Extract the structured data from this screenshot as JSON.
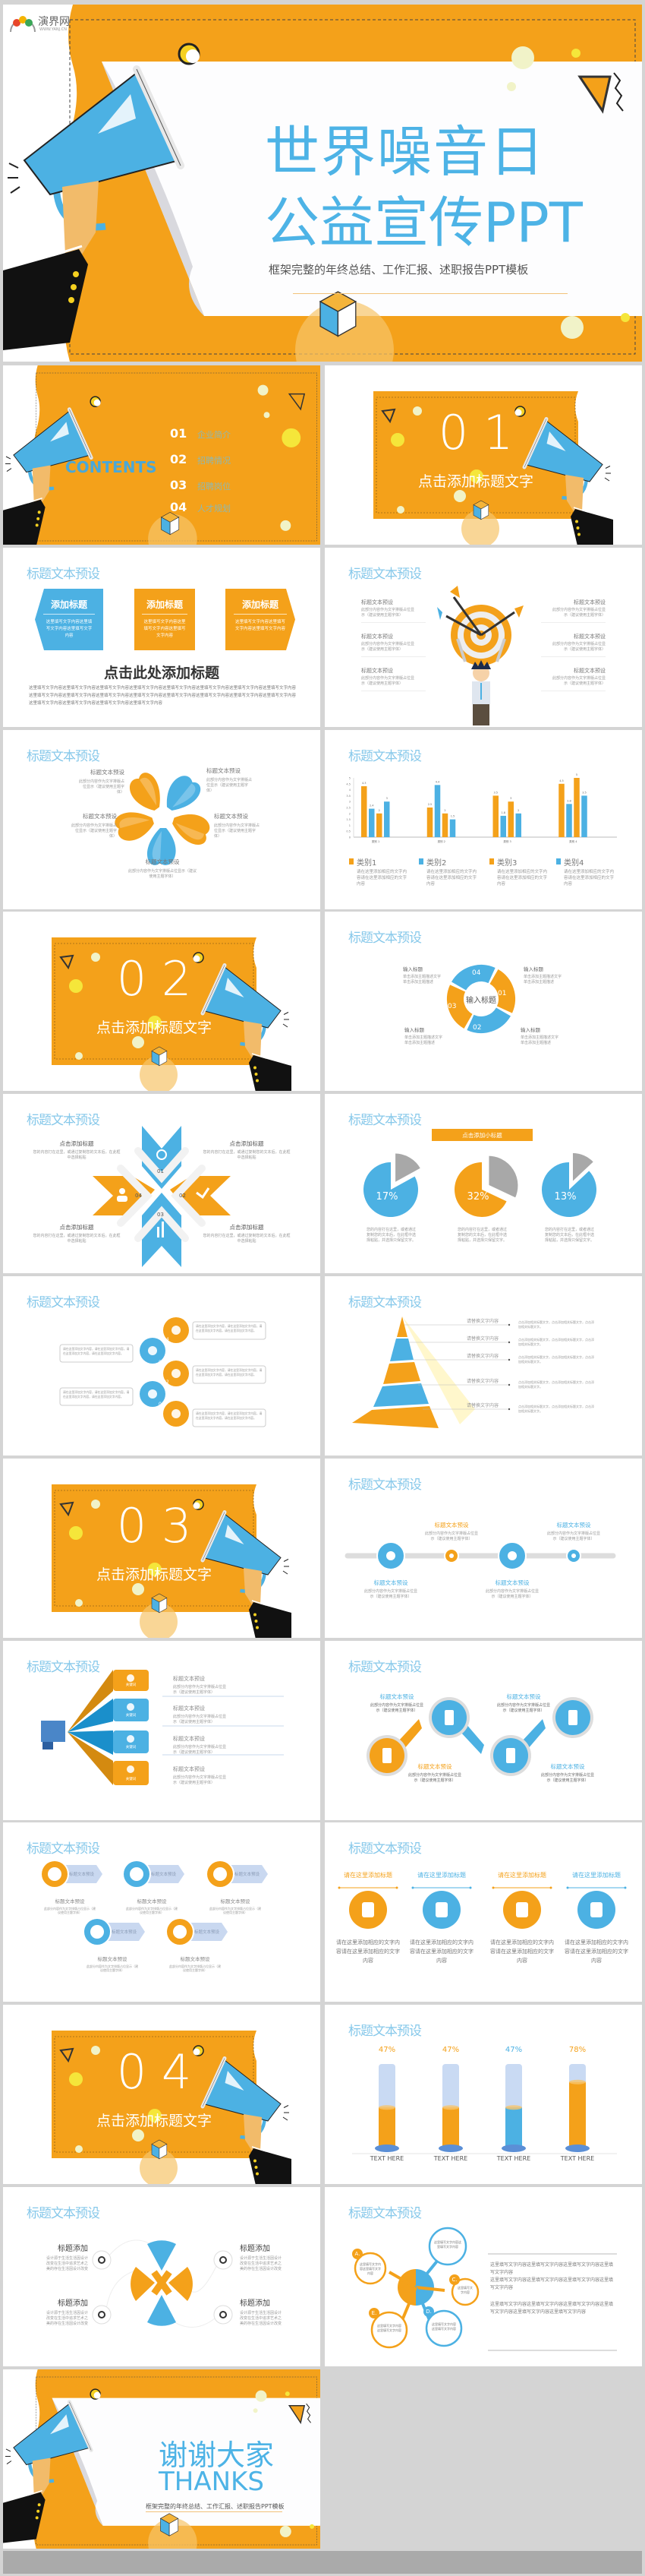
{
  "brand": {
    "logo_text": "演界网",
    "logo_url": "WWW.YANJ.CN"
  },
  "colors": {
    "orange": "#f4a11a",
    "blue": "#4cb1e3",
    "title_blue": "#86c8ea",
    "page_bg": "#d4d4d4",
    "sleeve": "#111111",
    "hand": "#f2bb6a"
  },
  "cover": {
    "title_line1": "世界噪音日",
    "title_line2": "公益宣传PPT",
    "subtitle": "框架完整的年终总结、工作汇报、述职报告PPT模板"
  },
  "slide_title": "标题文本预设",
  "contents": {
    "heading": "CONTENTS",
    "items": [
      {
        "num": "01",
        "label": "企业简介"
      },
      {
        "num": "02",
        "label": "招聘情况"
      },
      {
        "num": "03",
        "label": "招聘岗位"
      },
      {
        "num": "04",
        "label": "人才规划"
      }
    ]
  },
  "sections": [
    {
      "number": "0 1",
      "title": "点击添加标题文字"
    },
    {
      "number": "0 2",
      "title": "点击添加标题文字"
    },
    {
      "number": "0 3",
      "title": "点击添加标题文字"
    },
    {
      "number": "0 4",
      "title": "点击添加标题文字"
    }
  ],
  "three_boxes": {
    "boxes": [
      {
        "title": "添加标题",
        "text": "这里填写文字内容这里填写文字内容这里填写文字内容"
      },
      {
        "title": "添加标题",
        "text": "这里填写文字内容这里填写文字内容这里填写文字内容"
      },
      {
        "title": "添加标题",
        "text": "这里填写文字内容这里填写文字内容这里填写文字内容"
      }
    ],
    "heading": "点击此处添加标题",
    "paragraph": "这里填写文字内容这里填写文字内容这里填写文字内容这里填写文字内容这里填写文字内容这里填写文字内容这里填写文字内容这里填写文字内容这里填写文字内容这里填写文字内容这里填写文字内容这里填写文字内容这里填写文字内容这里填写文字内容这里填写文字内容这里填写文字内容这里填写文字内容这里填写文字内容这里填写文字内容这里填写文字内容"
  },
  "target": {
    "items": [
      {
        "title": "标题文本预设",
        "text": "此部分内容作为文字排版占位显示（建议使用主题字体）"
      },
      {
        "title": "标题文本预设",
        "text": "此部分内容作为文字排版占位显示（建议使用主题字体）"
      },
      {
        "title": "标题文本预设",
        "text": "此部分内容作为文字排版占位显示（建议使用主题字体）"
      },
      {
        "title": "标题文本预设",
        "text": "此部分内容作为文字排版占位显示（建议使用主题字体）"
      },
      {
        "title": "标题文本预设",
        "text": "此部分内容作为文字排版占位显示（建议使用主题字体）"
      },
      {
        "title": "标题文本预设",
        "text": "此部分内容作为文字排版占位显示（建议使用主题字体）"
      }
    ]
  },
  "flower": {
    "items": [
      {
        "title": "标题文本预设",
        "text": "此部分内容作为文字排版占位显示（建议使用主题字体）"
      },
      {
        "title": "标题文本预设",
        "text": "此部分内容作为文字排版占位显示（建议使用主题字体）"
      },
      {
        "title": "标题文本预设",
        "text": "此部分内容作为文字排版占位显示（建议使用主题字体）"
      },
      {
        "title": "标题文本预设",
        "text": "此部分内容作为文字排版占位显示（建议使用主题字体）"
      },
      {
        "title": "标题文本预设",
        "text": "此部分内容作为文字排版占位显示（建议使用主题字体）"
      }
    ]
  },
  "chart_data": {
    "type": "bar",
    "categories": [
      "类别 1",
      "类别 2",
      "类别 3",
      "类别 4"
    ],
    "series": [
      {
        "name": "类别1",
        "color": "#f4a11a",
        "values": [
          4.3,
          2.5,
          3.5,
          4.5
        ]
      },
      {
        "name": "类别2",
        "color": "#4cb1e3",
        "values": [
          2.4,
          4.4,
          1.8,
          2.8
        ]
      },
      {
        "name": "类别3",
        "color": "#f4a11a",
        "values": [
          2,
          2,
          3,
          5
        ]
      },
      {
        "name": "类别4",
        "color": "#4cb1e3",
        "values": [
          3,
          1.5,
          2,
          3.5
        ]
      }
    ],
    "ylim": [
      0,
      5
    ],
    "yticks": [
      "0",
      "0.5",
      "1",
      "1.5",
      "2",
      "2.5",
      "3",
      "3.5",
      "4",
      "4.5",
      "5"
    ],
    "grid": false,
    "data_labels": true,
    "legend_placement": "bottom",
    "legend_descriptions": [
      "请在这里添加相应的文字内容请在这里添加相应的文字内容",
      "请在这里添加相应的文字内容请在这里添加相应的文字内容",
      "请在这里添加相应的文字内容请在这里添加相应的文字内容",
      "请在这里添加相应的文字内容请在这里添加相应的文字内容"
    ]
  },
  "cycle": {
    "center": "输入标题",
    "segments": [
      "01",
      "02",
      "03",
      "04"
    ],
    "items": [
      {
        "title": "输入标题",
        "text": "单击添加主题描述文字单击添加主题描述"
      },
      {
        "title": "输入标题",
        "text": "单击添加主题描述文字单击添加主题描述"
      },
      {
        "title": "输入标题",
        "text": "单击添加主题描述文字单击添加主题描述"
      },
      {
        "title": "输入标题",
        "text": "单击添加主题描述文字单击添加主题描述"
      }
    ]
  },
  "cross": {
    "numbers": [
      "01",
      "02",
      "03",
      "04"
    ],
    "icons": [
      "lightbulb-icon",
      "twitter-icon",
      "bar-chart-icon",
      "users-icon"
    ],
    "items": [
      {
        "title": "点击添加标题",
        "text": "您的内容打在这里，或通过复制您的文本后，在此框中选择粘贴"
      },
      {
        "title": "点击添加标题",
        "text": "您的内容打在这里，或通过复制您的文本后，在此框中选择粘贴"
      },
      {
        "title": "点击添加标题",
        "text": "您的内容打在这里，或通过复制您的文本后，在此框中选择粘贴"
      },
      {
        "title": "点击添加标题",
        "text": "您的内容打在这里，或通过复制您的文本后，在此框中选择粘贴"
      }
    ]
  },
  "pies": {
    "banner": "点击添加小标题",
    "items": [
      {
        "percent": 17,
        "label": "17%",
        "color": "#4cb1e3",
        "text": "您的内容打在这里，或者通过复制您的文本后，在此框中选择粘贴，并选择只保留文字。"
      },
      {
        "percent": 32,
        "label": "32%",
        "color": "#f4a11a",
        "text": "您的内容打在这里，或者通过复制您的文本后，在此框中选择粘贴，并选择只保留文字。"
      },
      {
        "percent": 13,
        "label": "13%",
        "color": "#4cb1e3",
        "text": "您的内容打在这里，或者通过复制您的文本后，在此框中选择粘贴，并选择只保留文字。"
      }
    ]
  },
  "chain": {
    "numbers": [
      "01",
      "02",
      "03",
      "04"
    ],
    "icons": [
      "pen-icon",
      "thumbs-up-icon",
      "mail-icon",
      "truck-icon",
      "pie-chart-icon"
    ],
    "text": "请在这里添加文字内容，请在这里添加文字内容。请在这里添加文字内容，请在这里添加文字内容。"
  },
  "pyramid": {
    "items": [
      {
        "label": "请替换文字内容",
        "text": "点击添加相关标题文字，点击添加相关标题文字，点击添加相关标题文字。"
      },
      {
        "label": "请替换文字内容",
        "text": "点击添加相关标题文字，点击添加相关标题文字，点击添加相关标题文字。"
      },
      {
        "label": "请替换文字内容",
        "text": "点击添加相关标题文字，点击添加相关标题文字，点击添加相关标题文字。"
      },
      {
        "label": "请替换文字内容",
        "text": "点击添加相关标题文字，点击添加相关标题文字，点击添加相关标题文字。"
      },
      {
        "label": "请替换文字内容",
        "text": "点击添加相关标题文字，点击添加相关标题文字，点击添加相关标题文字。"
      }
    ]
  },
  "timeline": {
    "items": [
      {
        "title": "标题文本预设",
        "text": "此部分内容作为文字排版占位显示（建议使用主题字体）",
        "icon": "twitter-icon"
      },
      {
        "title": "标题文本预设",
        "text": "此部分内容作为文字排版占位显示（建议使用主题字体）",
        "icon": "check-icon"
      },
      {
        "title": "标题文本预设",
        "text": "此部分内容作为文字排版占位显示（建议使用主题字体）",
        "icon": "instagram-icon"
      },
      {
        "title": "标题文本预设",
        "text": "此部分内容作为文字排版占位显示（建议使用主题字体）",
        "icon": "vimeo-icon"
      }
    ]
  },
  "fold": {
    "keyword": "关键词",
    "items": [
      {
        "title": "标题文本预设",
        "text": "此部分内容作为文字排版占位显示（建议使用主题字体）",
        "icon": "magic-wand-icon"
      },
      {
        "title": "标题文本预设",
        "text": "此部分内容作为文字排版占位显示（建议使用主题字体）",
        "icon": "rss-icon"
      },
      {
        "title": "标题文本预设",
        "text": "此部分内容作为文字排版占位显示（建议使用主题字体）",
        "icon": "umbrella-icon"
      },
      {
        "title": "标题文本预设",
        "text": "此部分内容作为文字排版占位显示（建议使用主题字体）",
        "icon": "calendar-icon"
      }
    ]
  },
  "magnifier": {
    "items": [
      {
        "title": "标题文本预设",
        "text": "此部分内容作为文字排版占位显示（建议使用主题字体）"
      },
      {
        "title": "标题文本预设",
        "text": "此部分内容作为文字排版占位显示（建议使用主题字体）"
      },
      {
        "title": "标题文本预设",
        "text": "此部分内容作为文字排版占位显示（建议使用主题字体）"
      },
      {
        "title": "标题文本预设",
        "text": "此部分内容作为文字排版占位显示（建议使用主题字体）"
      }
    ]
  },
  "arrows": {
    "items": [
      {
        "tag": "标题文本预设",
        "title": "标题文本预设",
        "text": "此部分内容作为文字排版占位显示（建议使用主题字体）",
        "icon": "calendar-icon"
      },
      {
        "tag": "标题文本预设",
        "title": "标题文本预设",
        "text": "此部分内容作为文字排版占位显示（建议使用主题字体）",
        "icon": "check-icon"
      },
      {
        "tag": "标题文本预设",
        "title": "标题文本预设",
        "text": "此部分内容作为文字排版占位显示（建议使用主题字体）",
        "icon": "instagram-icon"
      },
      {
        "tag": "标题文本预设",
        "title": "标题文本预设",
        "text": "此部分内容作为文字排版占位显示（建议使用主题字体）",
        "icon": "check-icon"
      },
      {
        "tag": "标题文本预设",
        "title": "标题文本预设",
        "text": "此部分内容作为文字排版占位显示（建议使用主题字体）",
        "icon": "instagram-icon"
      }
    ]
  },
  "columns": {
    "items": [
      {
        "title": "请在这里添加标题",
        "text": "请在这里添加相应的文字内容请在这里添加相应的文字内容",
        "icon": "money-bag-icon"
      },
      {
        "title": "请在这里添加标题",
        "text": "请在这里添加相应的文字内容请在这里添加相应的文字内容",
        "icon": "train-icon"
      },
      {
        "title": "请在这里添加标题",
        "text": "请在这里添加相应的文字内容请在这里添加相应的文字内容",
        "icon": "briefcase-dollar-icon"
      },
      {
        "title": "请在这里添加标题",
        "text": "请在这里添加相应的文字内容请在这里添加相应的文字内容",
        "icon": "credit-card-icon"
      }
    ]
  },
  "thermo": {
    "items": [
      {
        "percent": 47,
        "label": "47%",
        "caption": "TEXT HERE",
        "color": "#f4a11a"
      },
      {
        "percent": 47,
        "label": "47%",
        "caption": "TEXT HERE",
        "color": "#f4a11a"
      },
      {
        "percent": 47,
        "label": "47%",
        "caption": "TEXT HERE",
        "color": "#4cb1e3"
      },
      {
        "percent": 78,
        "label": "78%",
        "caption": "TEXT HERE",
        "color": "#f4a11a"
      }
    ]
  },
  "orbit": {
    "items": [
      {
        "title": "标题添加",
        "text": "设计源于生活生活因设计改变在生活中追求艺术之美的存在生活因设计改变",
        "icon": "trophy-icon"
      },
      {
        "title": "标题添加",
        "text": "设计源于生活生活因设计改变在生活中追求艺术之美的存在生活因设计改变",
        "icon": "search-icon"
      },
      {
        "title": "标题添加",
        "text": "设计源于生活生活因设计改变在生活中追求艺术之美的存在生活因设计改变",
        "icon": "gear-icon"
      },
      {
        "title": "标题添加",
        "text": "设计源于生活生活因设计改变在生活中追求艺术之美的存在生活因设计改变",
        "icon": "map-pin-icon"
      }
    ]
  },
  "mindmap": {
    "nodes": [
      {
        "letter": "A.",
        "text": "这里填写文字内容这里填写文字内容"
      },
      {
        "letter": "",
        "text": "这里填写文字内容这里填写文字内容"
      },
      {
        "letter": "C.",
        "text": "这里填写文字内容"
      },
      {
        "letter": "D.",
        "text": "这里填写文字内容这里填写文字内容"
      },
      {
        "letter": "E.",
        "text": "这里填写文字内容这里填写文字内容"
      }
    ],
    "paragraphs": [
      "这里填写文字内容这里填写文字内容这里填写文字内容这里填写文字内容",
      "这里填写文字内容这里填写文字内容这里填写文字内容这里填写文字内容",
      "这里填写文字内容这里填写文字内容这里填写文字内容这里填写文字内容这里填写文字内容这里填写文字内容"
    ]
  },
  "thanks": {
    "line1": "谢谢大家",
    "line2": "THANKS",
    "subtitle": "框架完整的年终总结、工作汇报、述职报告PPT模板"
  }
}
